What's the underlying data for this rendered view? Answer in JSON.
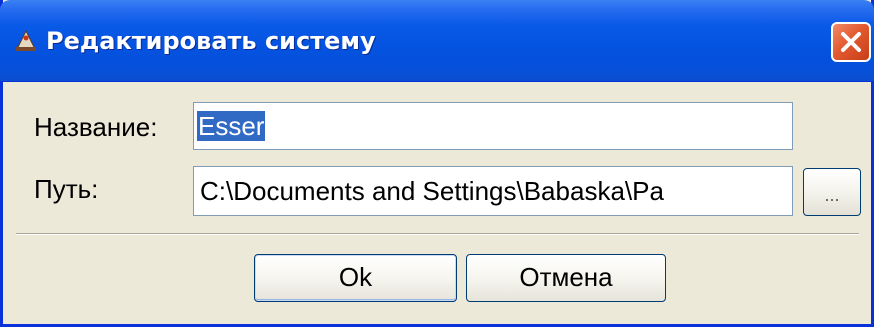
{
  "window": {
    "title": "Редактировать систему",
    "icon": "app-icon",
    "close_icon": "close-icon"
  },
  "form": {
    "name_label": "Название:",
    "name_value": "Esser",
    "path_label": "Путь:",
    "path_value": "C:\\Documents and Settings\\Babaska\\Pa",
    "browse_label": "..."
  },
  "buttons": {
    "ok_label": "Ok",
    "cancel_label": "Отмена"
  },
  "colors": {
    "titlebar": "#0553e1",
    "window_bg": "#ece9d8",
    "selection": "#316ac5",
    "close_button": "#e35a30"
  }
}
